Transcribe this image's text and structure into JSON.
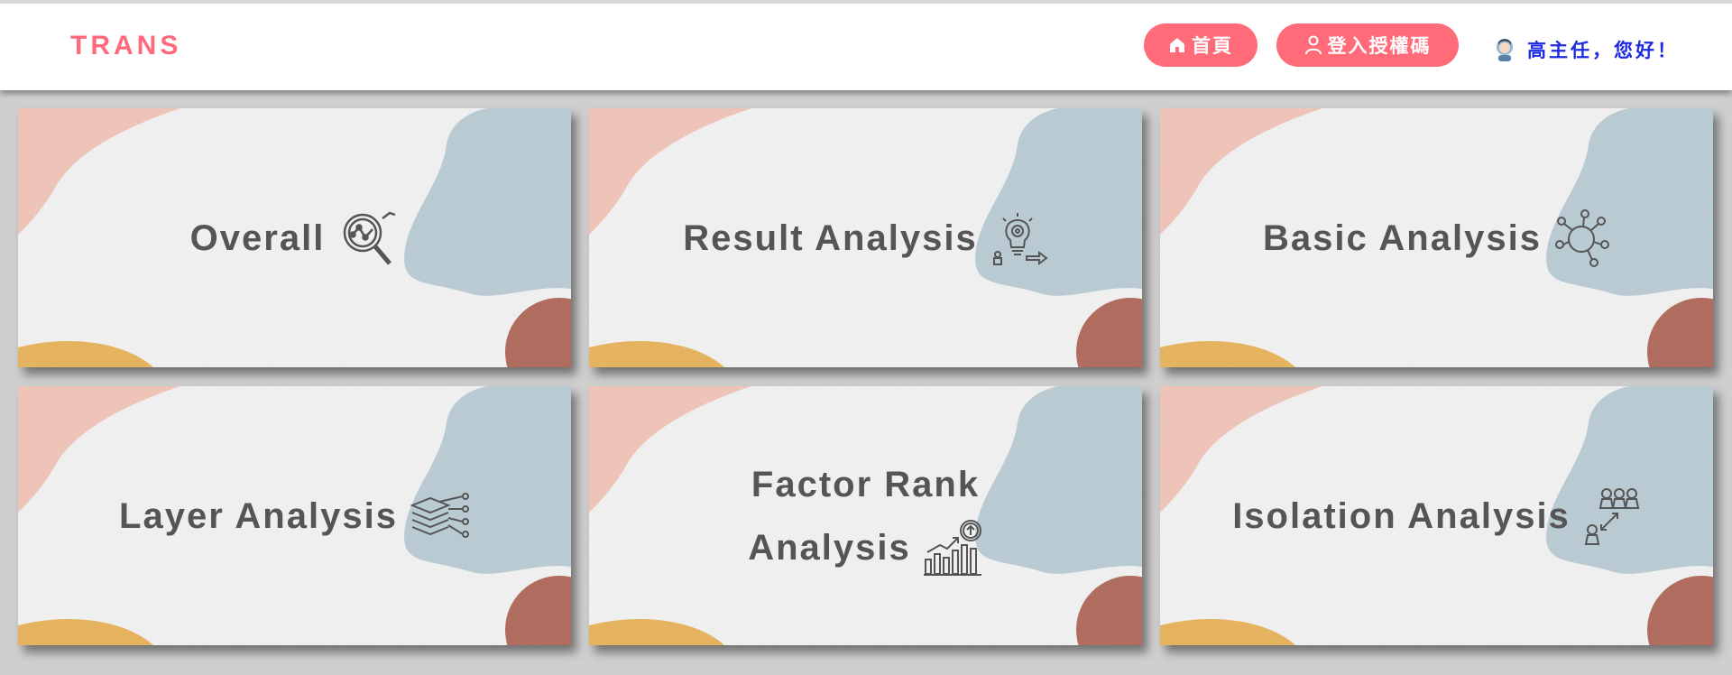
{
  "header": {
    "brand": "TRANS",
    "home_label": "首頁",
    "login_label": "登入授權碼",
    "greeting": "高主任，您好！"
  },
  "cards": [
    {
      "title": "Overall",
      "icon": "magnifier-chart-icon"
    },
    {
      "title": "Result Analysis",
      "icon": "lightbulb-gear-icon"
    },
    {
      "title": "Basic Analysis",
      "icon": "network-nodes-icon"
    },
    {
      "title": "Layer Analysis",
      "icon": "layers-icon"
    },
    {
      "title_line1": "Factor Rank",
      "title_line2": "Analysis",
      "icon": "growth-chart-icon"
    },
    {
      "title": "Isolation Analysis",
      "icon": "people-isolation-icon"
    }
  ],
  "colors": {
    "brand": "#ff6b7d",
    "button": "#ff6b79",
    "greeting": "#1f2be0",
    "card_text": "#555555",
    "blob_pink": "#f0c4b8",
    "blob_blue": "#b9cbd3",
    "blob_brown": "#b06a5b",
    "blob_yellow": "#e7b35c"
  }
}
